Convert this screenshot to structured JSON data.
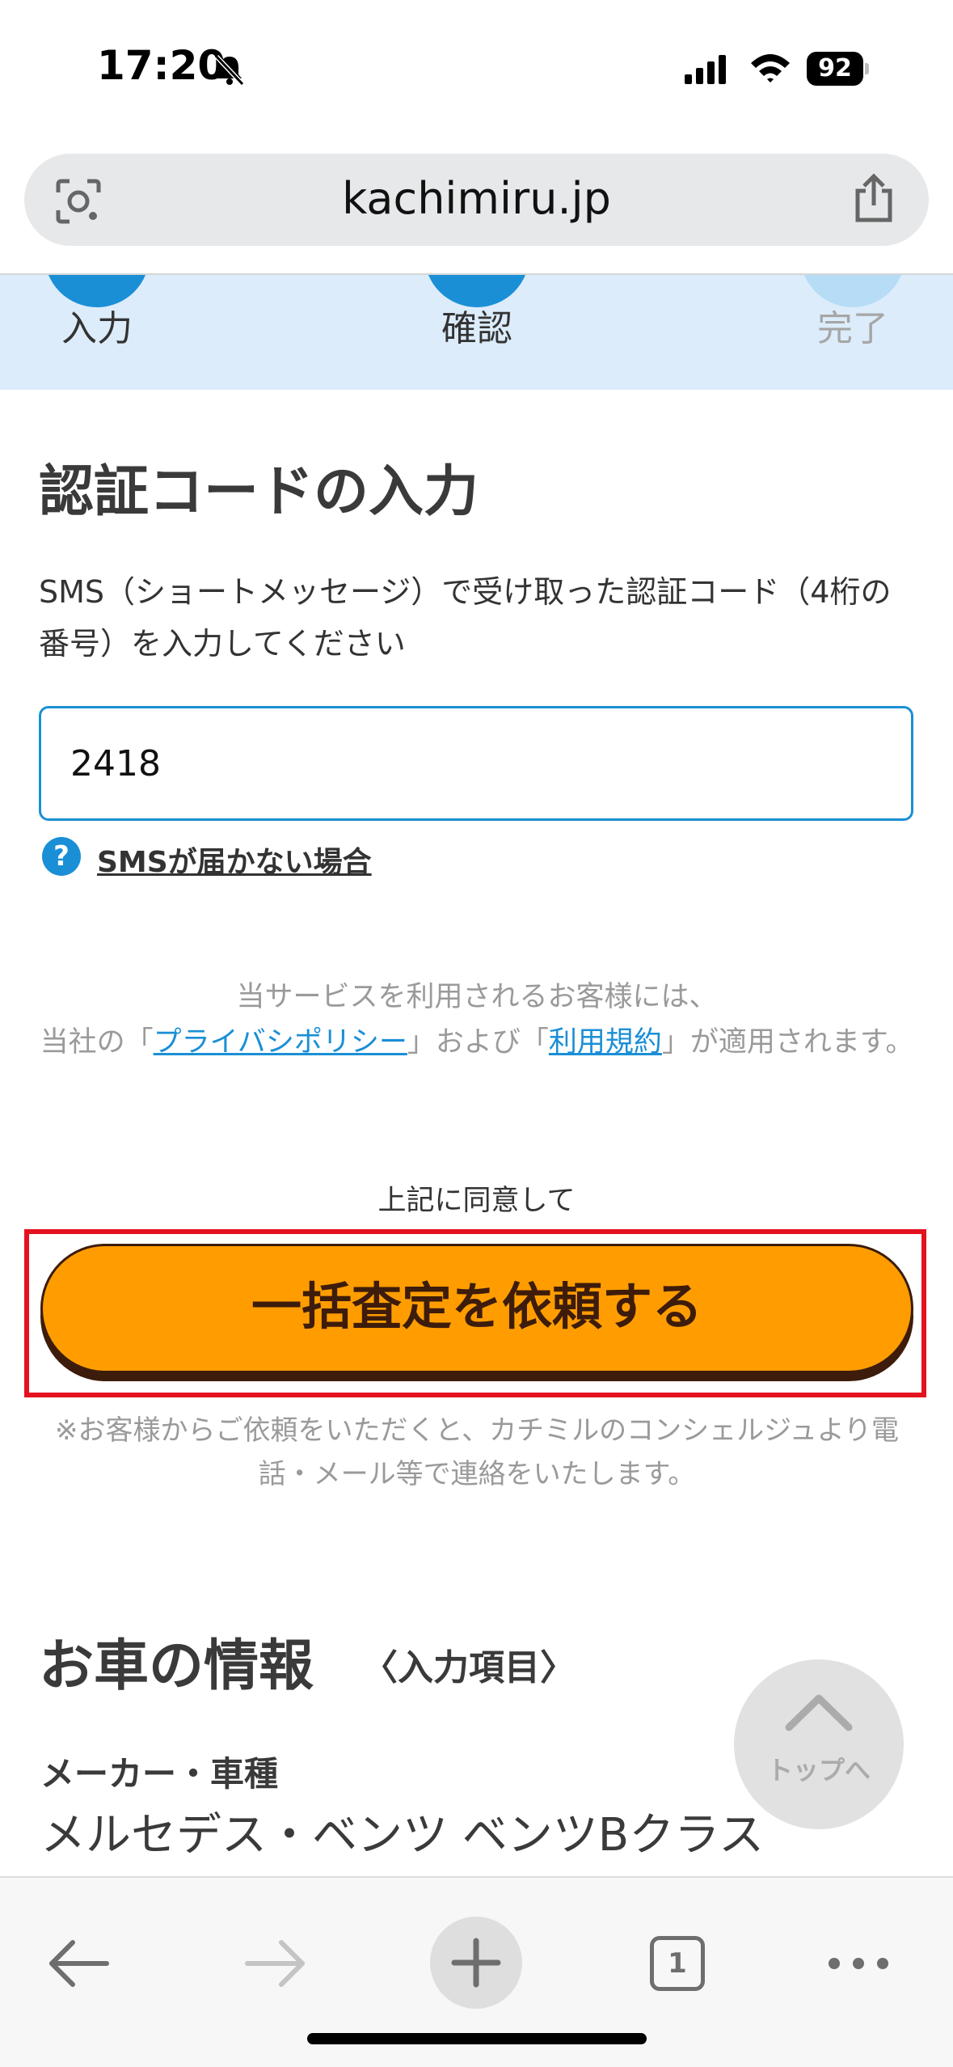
{
  "status_bar": {
    "time": "17:20",
    "battery": "92",
    "icons": [
      "bell-slash-icon",
      "signal-icon",
      "wifi-icon",
      "battery-icon"
    ]
  },
  "browser": {
    "url": "kachimiru.jp",
    "icons": [
      "lens-icon",
      "share-icon"
    ]
  },
  "steps": [
    {
      "label": "入力",
      "state": "done"
    },
    {
      "label": "確認",
      "state": "current"
    },
    {
      "label": "完了",
      "state": "upcoming"
    }
  ],
  "verification": {
    "title": "認証コードの入力",
    "description": "SMS（ショートメッセージ）で受け取った認証コード（4桁の番号）を入力してください",
    "code_value": "2418",
    "help_link": "SMSが届かない場合"
  },
  "consent": {
    "line1": "当サービスを利用されるお客様には、",
    "prefix": "当社の「",
    "privacy_link": "プライバシポリシー",
    "middle": "」および「",
    "terms_link": "利用規約",
    "suffix": "」が適用されます。"
  },
  "submit": {
    "agree_text": "上記に同意して",
    "button_label": "一括査定を依頼する",
    "note": "※お客様からご依頼をいただくと、カチミルのコンシェルジュより電話・メール等で連絡をいたします。"
  },
  "car_info": {
    "title": "お車の情報",
    "subtitle": "〈入力項目〉",
    "maker_label": "メーカー・車種",
    "maker_value": "メルセデス・ベンツ ベンツBクラス"
  },
  "to_top": {
    "label": "トップへ"
  },
  "toolbar": {
    "tab_count": "1",
    "icons": [
      "back-arrow-icon",
      "forward-arrow-icon",
      "new-tab-plus-icon",
      "tabs-icon",
      "more-icon"
    ]
  },
  "colors": {
    "accent_blue": "#1b8fd6",
    "button_orange": "#ff9d00",
    "button_border": "#3d1c0b",
    "highlight_red": "#e3121e",
    "steps_background": "#dcecfb"
  }
}
